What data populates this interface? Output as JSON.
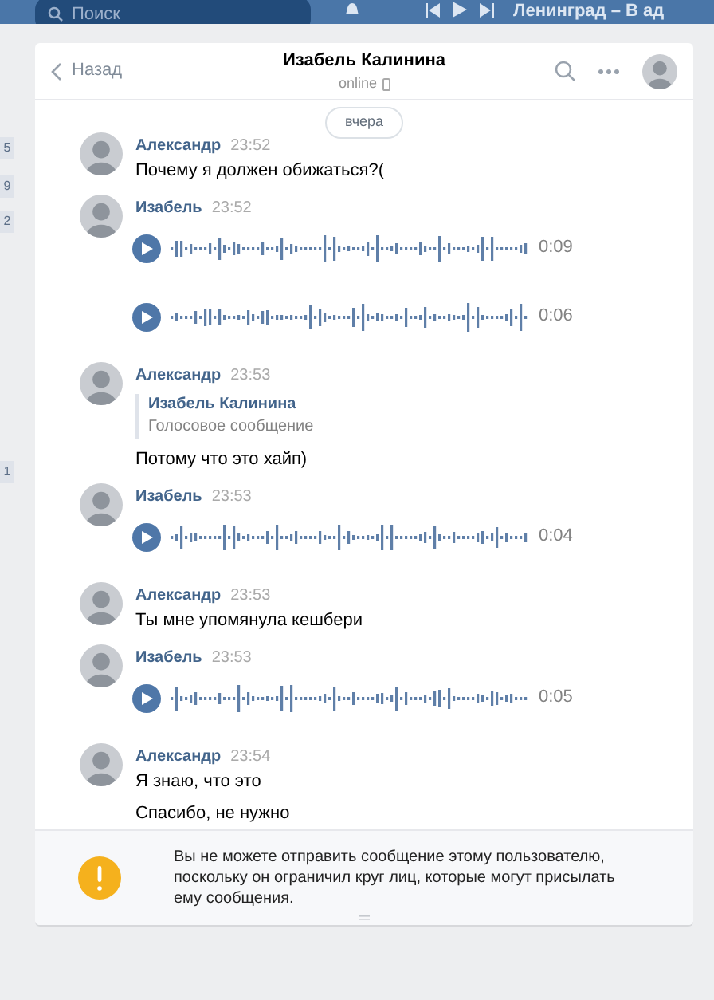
{
  "top_bar": {
    "search": {
      "placeholder": "Поиск"
    },
    "now_playing": "Ленинград – В ад"
  },
  "side_counters": [
    {
      "count": "5"
    },
    {
      "count": "9"
    },
    {
      "count": "2"
    },
    {
      "count": "1"
    }
  ],
  "header": {
    "back": "Назад",
    "title": "Изабель Калинина",
    "status": "online"
  },
  "date_pill": "вчера",
  "groups": [
    {
      "author": "Александр",
      "time": "23:52",
      "items": [
        {
          "kind": "text",
          "text": "Почему я должен обижаться?("
        }
      ]
    },
    {
      "author": "Изабель",
      "time": "23:52",
      "items": [
        {
          "kind": "voice",
          "duration": "0:09"
        },
        {
          "kind": "voice",
          "duration": "0:06"
        }
      ]
    },
    {
      "author": "Александр",
      "time": "23:53",
      "items": [
        {
          "kind": "forward",
          "name": "Изабель Калинина",
          "text": "Голосовое сообщение"
        },
        {
          "kind": "text",
          "text": "Потому что это хайп)"
        }
      ]
    },
    {
      "author": "Изабель",
      "time": "23:53",
      "items": [
        {
          "kind": "voice",
          "duration": "0:04"
        }
      ]
    },
    {
      "author": "Александр",
      "time": "23:53",
      "items": [
        {
          "kind": "text",
          "text": "Ты мне упомянула кешбери"
        }
      ]
    },
    {
      "author": "Изабель",
      "time": "23:53",
      "items": [
        {
          "kind": "voice",
          "duration": "0:05"
        }
      ]
    },
    {
      "author": "Александр",
      "time": "23:54",
      "items": [
        {
          "kind": "text",
          "text": "Я знаю, что это"
        },
        {
          "kind": "text",
          "text": "Спасибо, не нужно"
        }
      ]
    }
  ],
  "notice": "Вы не можете отправить сообщение этому пользователю, поскольку он ограничил круг лиц, которые могут присылать ему сообщения."
}
